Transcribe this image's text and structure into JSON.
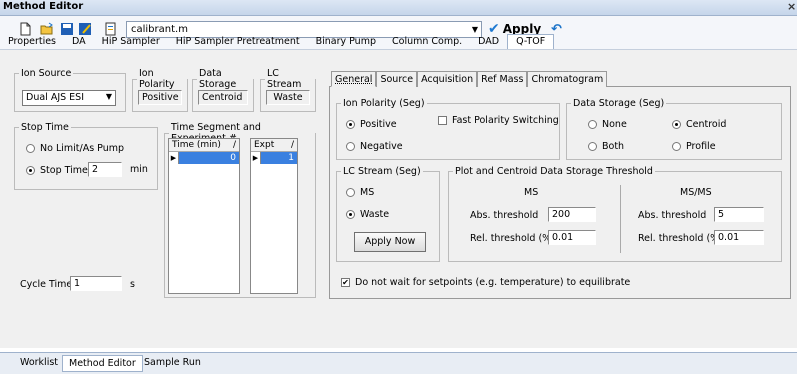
{
  "window": {
    "title": "Method Editor",
    "close_glyph": "×"
  },
  "toolbar": {
    "method_name": "calibrant.m",
    "apply_label": "Apply",
    "icons": [
      "new-icon",
      "open-icon",
      "save-icon",
      "save-as-icon",
      "print-icon",
      "apply-check-icon",
      "undo-icon"
    ]
  },
  "module_tabs": [
    "Properties",
    "DA",
    "HiP Sampler",
    "HiP Sampler Pretreatment",
    "Binary Pump",
    "Column Comp.",
    "DAD",
    "Q-TOF"
  ],
  "active_module_tab": "Q-TOF",
  "left": {
    "ion_source": {
      "label": "Ion Source",
      "value": "Dual AJS ESI"
    },
    "ion_polarity": {
      "label": "Ion Polarity",
      "value": "Positive"
    },
    "data_storage": {
      "label": "Data Storage",
      "value": "Centroid"
    },
    "lc_stream": {
      "label": "LC Stream",
      "value": "Waste"
    },
    "stop_time": {
      "label": "Stop Time",
      "option_nolimit": "No Limit/As Pump",
      "option_stoptime": "Stop Time",
      "value": "2",
      "unit": "min"
    },
    "time_segment": {
      "label": "Time Segment and Experiment #",
      "time_header": "Time (min)",
      "time_value": "0",
      "expt_header": "Expt",
      "expt_value": "1"
    },
    "cycle_time": {
      "label": "Cycle Time",
      "value": "1",
      "unit": "s"
    }
  },
  "qtof_tabs": [
    "General",
    "Source",
    "Acquisition",
    "Ref Mass",
    "Chromatogram"
  ],
  "general": {
    "ion_polarity_seg": {
      "label": "Ion Polarity (Seg)",
      "positive": "Positive",
      "negative": "Negative",
      "fast_switching": "Fast Polarity Switching"
    },
    "data_storage_seg": {
      "label": "Data Storage (Seg)",
      "none": "None",
      "centroid": "Centroid",
      "both": "Both",
      "profile": "Profile"
    },
    "lc_stream_seg": {
      "label": "LC Stream (Seg)",
      "ms": "MS",
      "waste": "Waste",
      "apply_now": "Apply Now"
    },
    "threshold": {
      "label": "Plot and Centroid Data Storage Threshold",
      "ms_header": "MS",
      "msms_header": "MS/MS",
      "abs_label": "Abs. threshold",
      "rel_label": "Rel. threshold (%)",
      "ms_abs": "200",
      "ms_rel": "0.01",
      "msms_abs": "5",
      "msms_rel": "0.01"
    },
    "no_wait": "Do not wait for setpoints (e.g. temperature) to equilibrate"
  },
  "bottom_tabs": [
    "Worklist",
    "Method Editor",
    "Sample Run"
  ],
  "active_bottom_tab": "Method Editor"
}
